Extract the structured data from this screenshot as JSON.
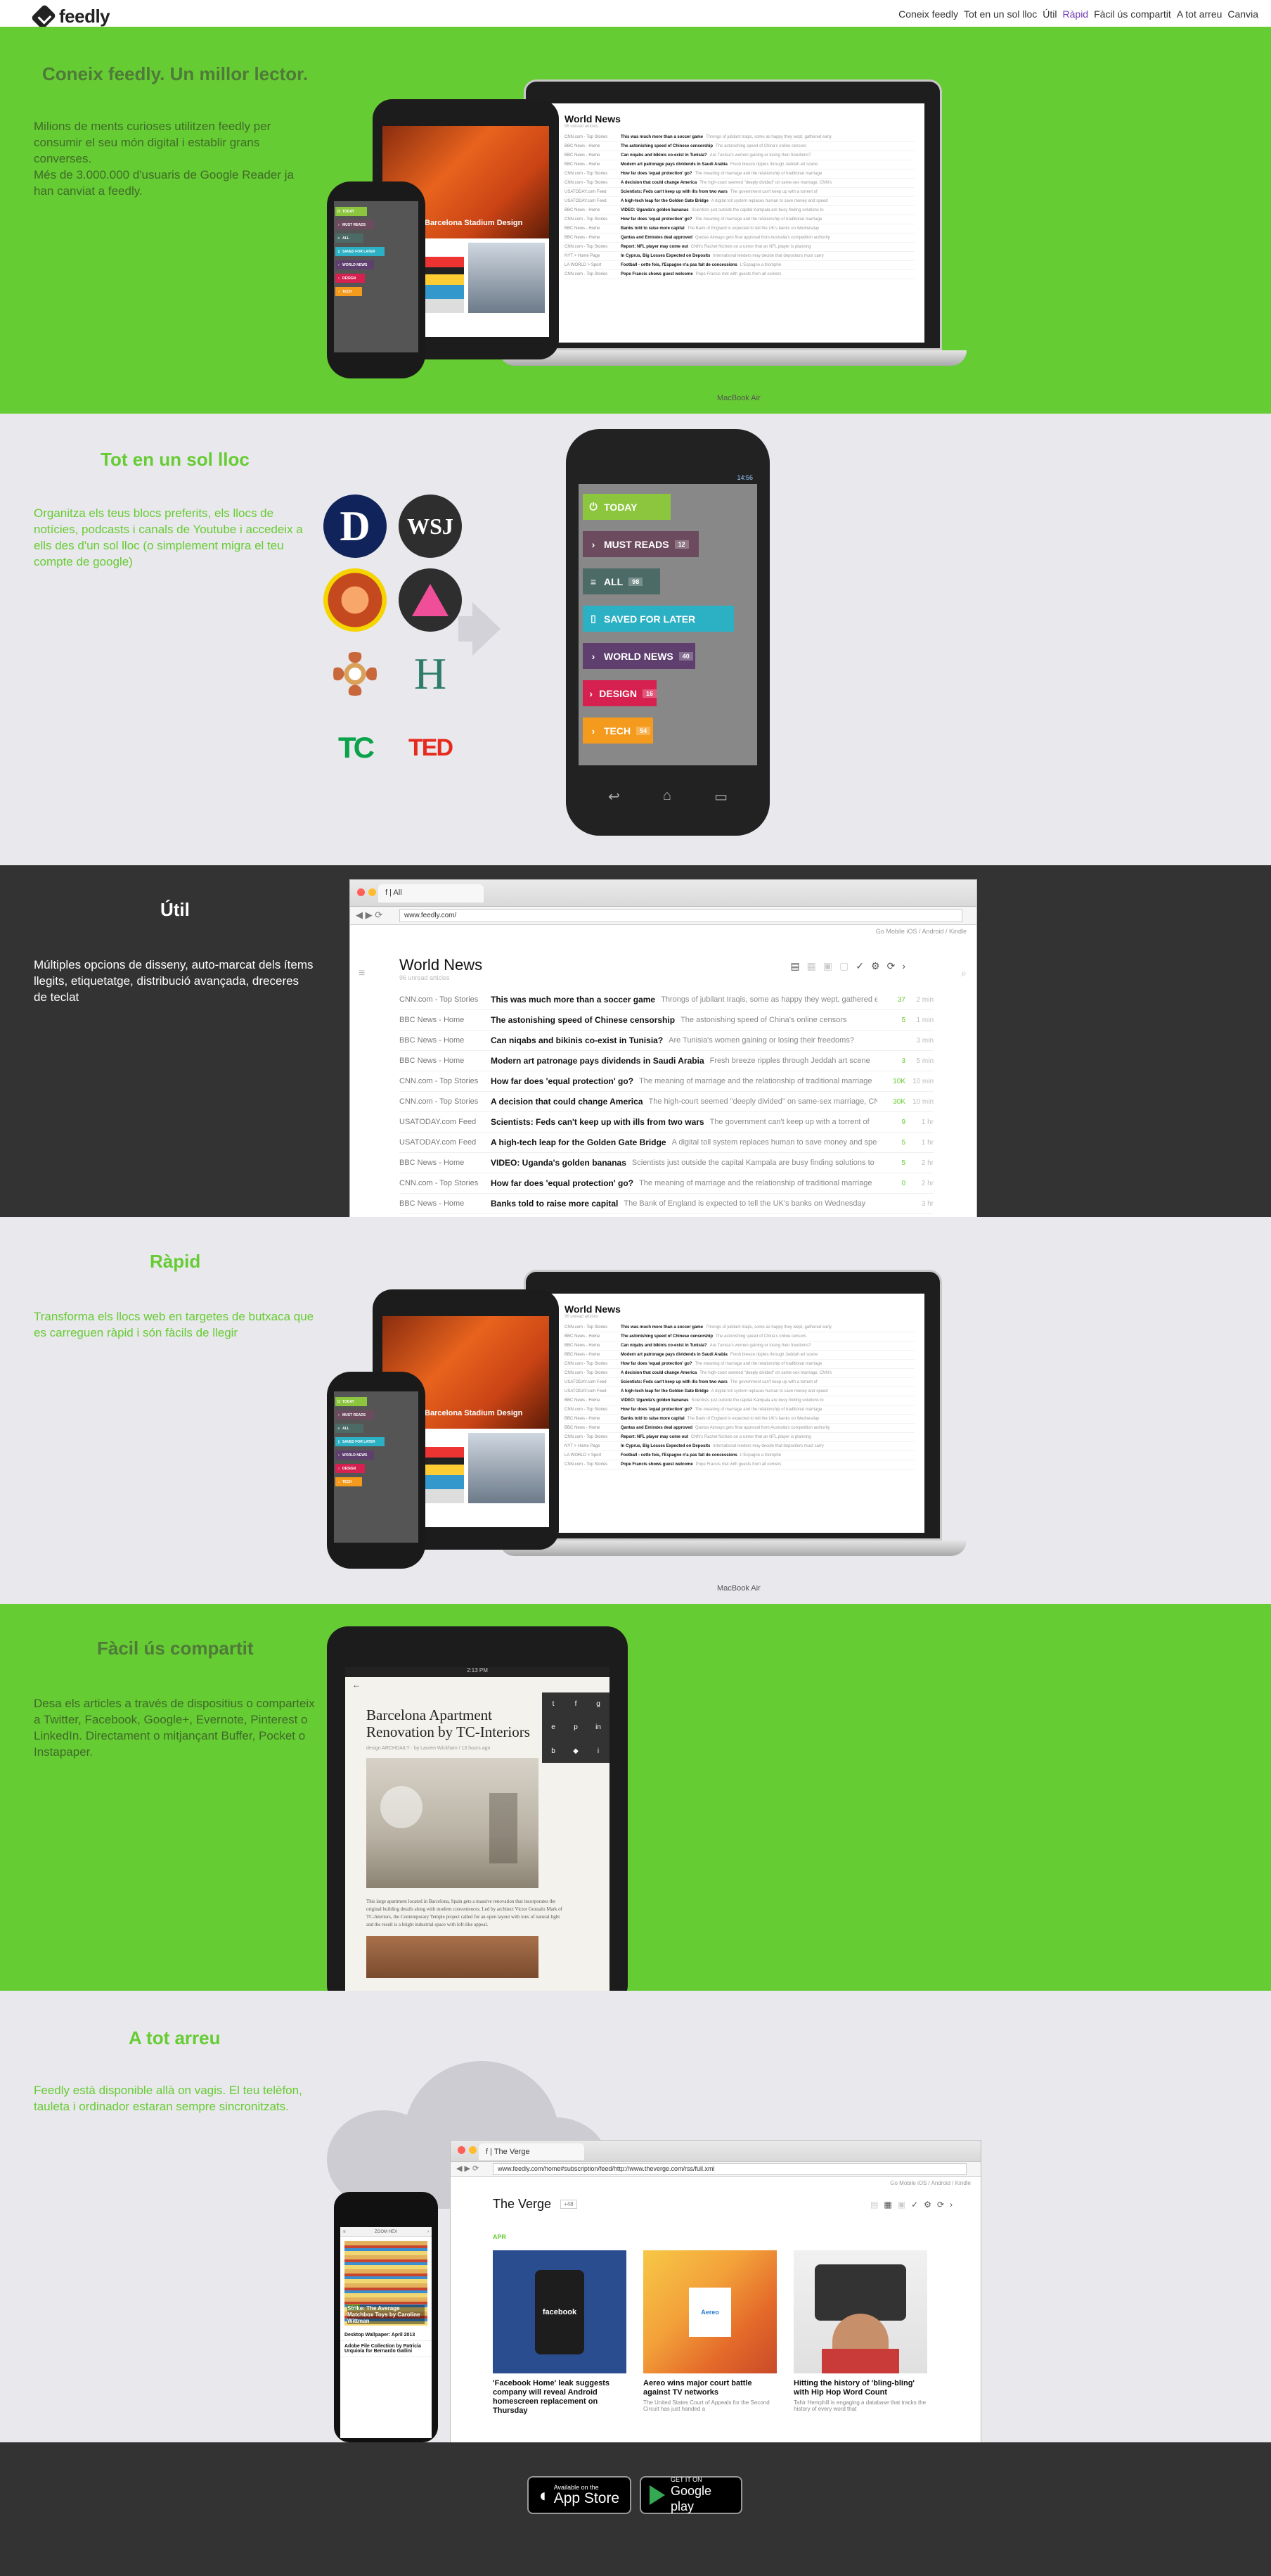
{
  "header": {
    "brand": "feedly",
    "nav": [
      "Coneix feedly",
      "Tot en un sol lloc",
      "Útil",
      "Ràpid",
      "Fàcil ús compartit",
      "A tot arreu",
      "Canvia"
    ]
  },
  "sections": {
    "s1": {
      "title": "Coneix feedly. Un millor lector.",
      "desc": "Milions de ments curioses utilitzen feedly per consumir el seu món digital i establir grans converses.\nMés de 3.000.000 d'usuaris de Google Reader ja han canviat a feedly."
    },
    "s2": {
      "title": "Tot en un sol lloc",
      "desc": "Organitza els teus blocs preferits, els llocs de notícies, podcasts i canals de Youtube i accedeix a ells des d'un sol lloc (o simplement migra el teu compte de google)"
    },
    "s3": {
      "title": "Útil",
      "desc": "Múltiples opcions de disseny, auto-marcat dels ítems llegits, etiquetatge, distribució avançada, dreceres de teclat"
    },
    "s4": {
      "title": "Ràpid",
      "desc": "Transforma els llocs web en targetes de butxaca que es carreguen ràpid i són fàcils de llegir"
    },
    "s5": {
      "title": "Fàcil ús compartit",
      "desc": "Desa els articles a través de dispositius o comparteix a Twitter, Facebook, Google+, Evernote, Pinterest o LinkedIn. Directament o mitjançant Buffer, Pocket o Instapaper."
    },
    "s6": {
      "title": "A tot arreu",
      "desc": "Feedly està disponible allà on vagis. El teu telèfon, tauleta i ordinador estaran sempre sincronitzats."
    }
  },
  "mini_app": {
    "title": "World News",
    "subtitle": "96 unread articles",
    "laptop_brand": "MacBook Air",
    "phone_status": "14:56",
    "tablet_header": "Barcelona Stadium Design",
    "rows": [
      {
        "src": "CNN.com - Top Stories",
        "title": "This was much more than a soccer game",
        "snip": "Throngs of jubilant Iraqis, some as happy they wept, gathered early"
      },
      {
        "src": "BBC News - Home",
        "title": "The astonishing speed of Chinese censorship",
        "snip": "The astonishing speed of China's online censors"
      },
      {
        "src": "BBC News - Home",
        "title": "Can niqabs and bikinis co-exist in Tunisia?",
        "snip": "Are Tunisia's women gaining or losing their freedoms?"
      },
      {
        "src": "BBC News - Home",
        "title": "Modern art patronage pays dividends in Saudi Arabia",
        "snip": "Fresh breeze ripples through Jeddah art scene"
      },
      {
        "src": "CNN.com - Top Stories",
        "title": "How far does 'equal protection' go?",
        "snip": "The meaning of marriage and the relationship of traditional marriage"
      },
      {
        "src": "CNN.com - Top Stories",
        "title": "A decision that could change America",
        "snip": "The high-court seemed \"deeply divided\" on same-sex marriage, CNN's"
      },
      {
        "src": "USATODAY.com Feed",
        "title": "Scientists: Feds can't keep up with ills from two wars",
        "snip": "The government can't keep up with a torrent of"
      },
      {
        "src": "USATODAY.com Feed",
        "title": "A high-tech leap for the Golden Gate Bridge",
        "snip": "A digital toll system replaces human to save money and speed"
      },
      {
        "src": "BBC News - Home",
        "title": "VIDEO: Uganda's golden bananas",
        "snip": "Scientists just outside the capital Kampala are busy finding solutions to"
      },
      {
        "src": "CNN.com - Top Stories",
        "title": "How far does 'equal protection' go?",
        "snip": "The meaning of marriage and the relationship of traditional marriage"
      },
      {
        "src": "BBC News - Home",
        "title": "Banks told to raise more capital",
        "snip": "The Bank of England is expected to tell the UK's banks on Wednesday"
      },
      {
        "src": "BBC News - Home",
        "title": "Qantas and Emirates deal approved",
        "snip": "Qantas Airways gets final approval from Australia's competition authority"
      },
      {
        "src": "CNN.com - Top Stories",
        "title": "Report: NFL player may come out",
        "snip": "CNN's Rachel Nichols on a rumor that an NFL player is planning"
      },
      {
        "src": "NYT > Home Page",
        "title": "In Cyprus, Big Losses Expected on Deposits",
        "snip": "International lenders may decide that depositors must carry"
      },
      {
        "src": "LA WORLD > Sport",
        "title": "Football - cette fois, l'Espagne n'a pas fait de concessions",
        "snip": "L'Espagne a triomphé"
      },
      {
        "src": "CNN.com - Top Stories",
        "title": "Pope Francis shows guest welcome",
        "snip": "Pope Francis met with guests from all corners"
      }
    ],
    "rows_big_counts": [
      "37",
      "5",
      "",
      "3",
      "10K",
      "30K",
      "9",
      "5",
      "5",
      "0",
      "",
      ""
    ],
    "rows_big_times": [
      "2 min",
      "1 min",
      "3 min",
      "5 min",
      "10 min",
      "10 min",
      "1 hr",
      "1 hr",
      "2 hr",
      "2 hr",
      "3 hr",
      "4 hr"
    ],
    "menu": [
      {
        "label": "Today",
        "color": "#8cc63f",
        "icon": "⏻",
        "count": ""
      },
      {
        "label": "Must Reads",
        "color": "#6d4b5e",
        "icon": "›",
        "count": "12"
      },
      {
        "label": "All",
        "color": "#4d6b66",
        "icon": "≡",
        "count": "98"
      },
      {
        "label": "Saved for later",
        "color": "#2bb0c4",
        "icon": "▯",
        "count": ""
      },
      {
        "label": "World News",
        "color": "#5e3f6e",
        "icon": "›",
        "count": "40"
      },
      {
        "label": "Design",
        "color": "#d6204f",
        "icon": "›",
        "count": "16"
      },
      {
        "label": "Tech",
        "color": "#f49a1c",
        "icon": "›",
        "count": "54"
      }
    ]
  },
  "browser1": {
    "tab": "f | All",
    "url": "www.feedly.com/",
    "top_links": "Go Mobile   iOS  /  Android  /  Kindle"
  },
  "tablet_article": {
    "title": "Barcelona Apartment Renovation by TC-Interiors",
    "meta": "design ARCHDAILY · by Lauren Wickham / 13 hours ago",
    "status_time": "2:13 PM",
    "body": "This large apartment located in Barcelona, Spain gets a massive renovation that incorporates the original building details along with modern conveniences. Led by architect Victor Gonzalo Mark of TC-Interiors, the Contemporary Temple project called for an open layout with tons of natural light and the result is a bright industrial space with loft-like appeal."
  },
  "verge": {
    "tab": "f | The Verge",
    "url": "www.feedly.com/home#subscription/feed/http://www.theverge.com/rss/full.xml",
    "title": "The Verge",
    "badge": "+48",
    "section_label": "APR",
    "top_links": "Go Mobile   iOS  /  Android  /  Kindle",
    "cards": [
      {
        "caption": "'Facebook Home' leak suggests company will reveal Android homescreen replacement on Thursday",
        "bg": "#2a4d8f",
        "art": "facebook"
      },
      {
        "caption": "Aereo wins major court battle against TV networks",
        "sub": "The United States Court of Appeals for the Second Circuit has just handed a",
        "bg": "#f3a13a",
        "art": "Aereo"
      },
      {
        "caption": "Hitting the history of 'bling-bling' with Hip Hop Word Count",
        "sub": "Tahir Hemphill is engaging a database that tracks the history of every word that",
        "bg": "#c83b38",
        "art": ""
      }
    ]
  },
  "iphone": {
    "status": "ZOOM HEX",
    "card1": "Strike: The Average Matchbox Toys by Caroline Wittman",
    "card1_tag": "NEW",
    "card2": "Desktop Wallpaper: April 2013",
    "card3": "Adobe File Collection by Patricia Urquiola for Bernardo Gallini"
  },
  "footer": {
    "appstore_small": "Available on the",
    "appstore_big": "App Store",
    "play_small": "GET IT ON",
    "play_big": "Google play"
  },
  "colors": {
    "green": "#66cc33",
    "light": "#e9e8ec",
    "dark": "#333333",
    "nav_active": "#6e3bb0"
  },
  "source_logos": [
    "D",
    "WSJ",
    "",
    "",
    "",
    "H",
    "TC",
    "TED"
  ]
}
